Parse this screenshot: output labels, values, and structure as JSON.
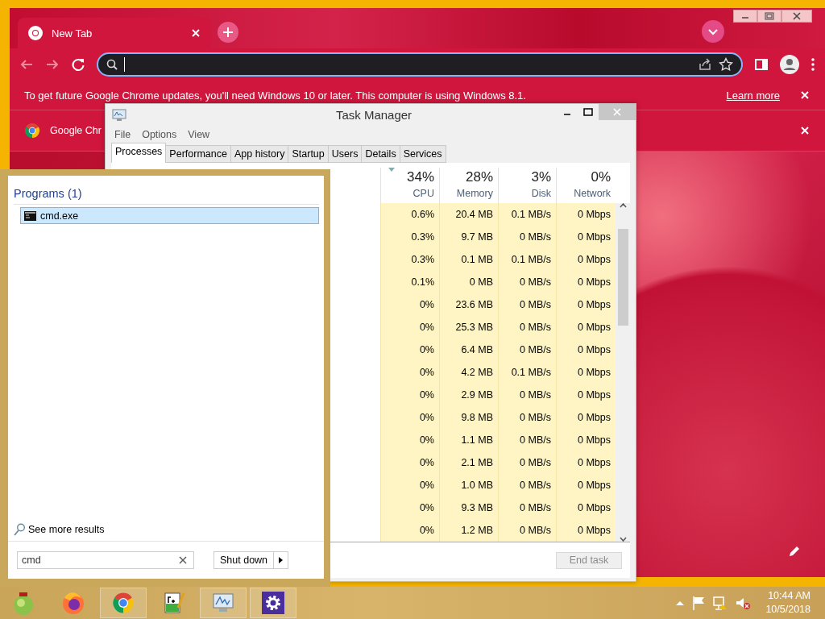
{
  "chrome": {
    "tabs": [
      {
        "title": "New Tab",
        "selected": true
      }
    ],
    "infobars": [
      {
        "text": "To get future Google Chrome updates, you'll need Windows 10 or later. This computer is using Windows 8.1.",
        "link": "Learn more"
      },
      {
        "text": "Google Chr"
      }
    ]
  },
  "task_manager": {
    "title": "Task Manager",
    "menu": [
      "File",
      "Options",
      "View"
    ],
    "tabs": [
      {
        "label": "Processes",
        "selected": true
      },
      {
        "label": "Performance",
        "selected": false
      },
      {
        "label": "App history",
        "selected": false
      },
      {
        "label": "Startup",
        "selected": false
      },
      {
        "label": "Users",
        "selected": false
      },
      {
        "label": "Details",
        "selected": false
      },
      {
        "label": "Services",
        "selected": false
      }
    ],
    "columns": [
      {
        "percent": "34%",
        "label": "CPU",
        "sorted": true
      },
      {
        "percent": "28%",
        "label": "Memory",
        "sorted": false
      },
      {
        "percent": "3%",
        "label": "Disk",
        "sorted": false
      },
      {
        "percent": "0%",
        "label": "Network",
        "sorted": false
      }
    ],
    "rows": [
      [
        "0.6%",
        "20.4 MB",
        "0.1 MB/s",
        "0 Mbps"
      ],
      [
        "0.3%",
        "9.7 MB",
        "0 MB/s",
        "0 Mbps"
      ],
      [
        "0.3%",
        "0.1 MB",
        "0.1 MB/s",
        "0 Mbps"
      ],
      [
        "0.1%",
        "0 MB",
        "0 MB/s",
        "0 Mbps"
      ],
      [
        "0%",
        "23.6 MB",
        "0 MB/s",
        "0 Mbps"
      ],
      [
        "0%",
        "25.3 MB",
        "0 MB/s",
        "0 Mbps"
      ],
      [
        "0%",
        "6.4 MB",
        "0 MB/s",
        "0 Mbps"
      ],
      [
        "0%",
        "4.2 MB",
        "0.1 MB/s",
        "0 Mbps"
      ],
      [
        "0%",
        "2.9 MB",
        "0 MB/s",
        "0 Mbps"
      ],
      [
        "0%",
        "9.8 MB",
        "0 MB/s",
        "0 Mbps"
      ],
      [
        "0%",
        "1.1 MB",
        "0 MB/s",
        "0 Mbps"
      ],
      [
        "0%",
        "2.1 MB",
        "0 MB/s",
        "0 Mbps"
      ],
      [
        "0%",
        "1.0 MB",
        "0 MB/s",
        "0 Mbps"
      ],
      [
        "0%",
        "9.3 MB",
        "0 MB/s",
        "0 Mbps"
      ],
      [
        "0%",
        "1.2 MB",
        "0 MB/s",
        "0 Mbps"
      ]
    ],
    "end_task": {
      "label": "End task",
      "disabled": true
    }
  },
  "start_search": {
    "heading": "Programs (1)",
    "results": [
      {
        "name": "cmd.exe",
        "selected": true
      }
    ],
    "see_more": "See more results",
    "search": {
      "value": "cmd"
    },
    "shutdown": "Shut down"
  },
  "taskbar": {
    "apps": [
      {
        "kind": "ornament",
        "running": false
      },
      {
        "kind": "firefox",
        "running": false
      },
      {
        "kind": "chrome",
        "running": true
      },
      {
        "kind": "notepad",
        "running": false
      },
      {
        "kind": "monitor",
        "running": true
      },
      {
        "kind": "settings",
        "running": true
      }
    ],
    "clock": {
      "time": "10:44 AM",
      "date": "10/5/2018"
    }
  }
}
